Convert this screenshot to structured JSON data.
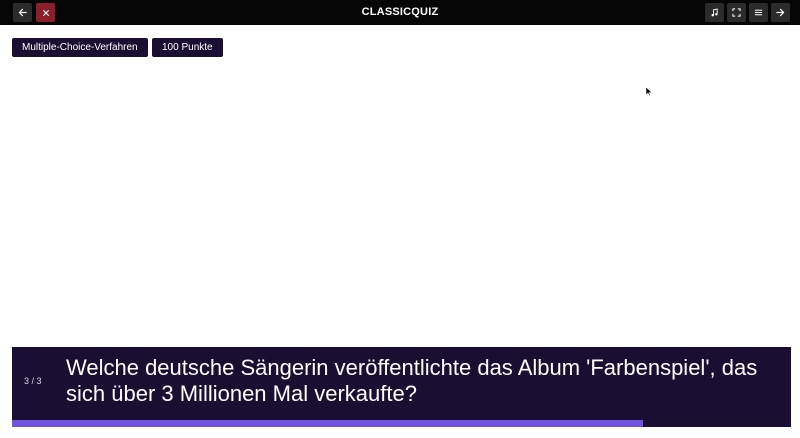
{
  "app": {
    "title": "CLASSICQUIZ"
  },
  "toolbar": {
    "left": [
      {
        "icon": "arrow-left-icon",
        "name": "back-button"
      },
      {
        "icon": "close-icon",
        "name": "close-button",
        "color": "#8a1f2b"
      }
    ],
    "right": [
      {
        "icon": "music-note-icon",
        "name": "music-button"
      },
      {
        "icon": "fullscreen-icon",
        "name": "fullscreen-button"
      },
      {
        "icon": "menu-icon",
        "name": "menu-button"
      },
      {
        "icon": "arrow-right-icon",
        "name": "next-button"
      }
    ]
  },
  "chips": {
    "mode": "Multiple-Choice-Verfahren",
    "points": "100 Punkte"
  },
  "question": {
    "counter": "3 / 3",
    "text": "Welche deutsche Sängerin veröffentlichte das Album 'Farbenspiel', das sich über 3 Millionen Mal verkaufte?"
  },
  "progress": {
    "fraction": 0.81
  },
  "colors": {
    "topbar": "#050505",
    "panel": "#1a0f33",
    "accent": "#6f52de",
    "close": "#8a1f2b"
  }
}
